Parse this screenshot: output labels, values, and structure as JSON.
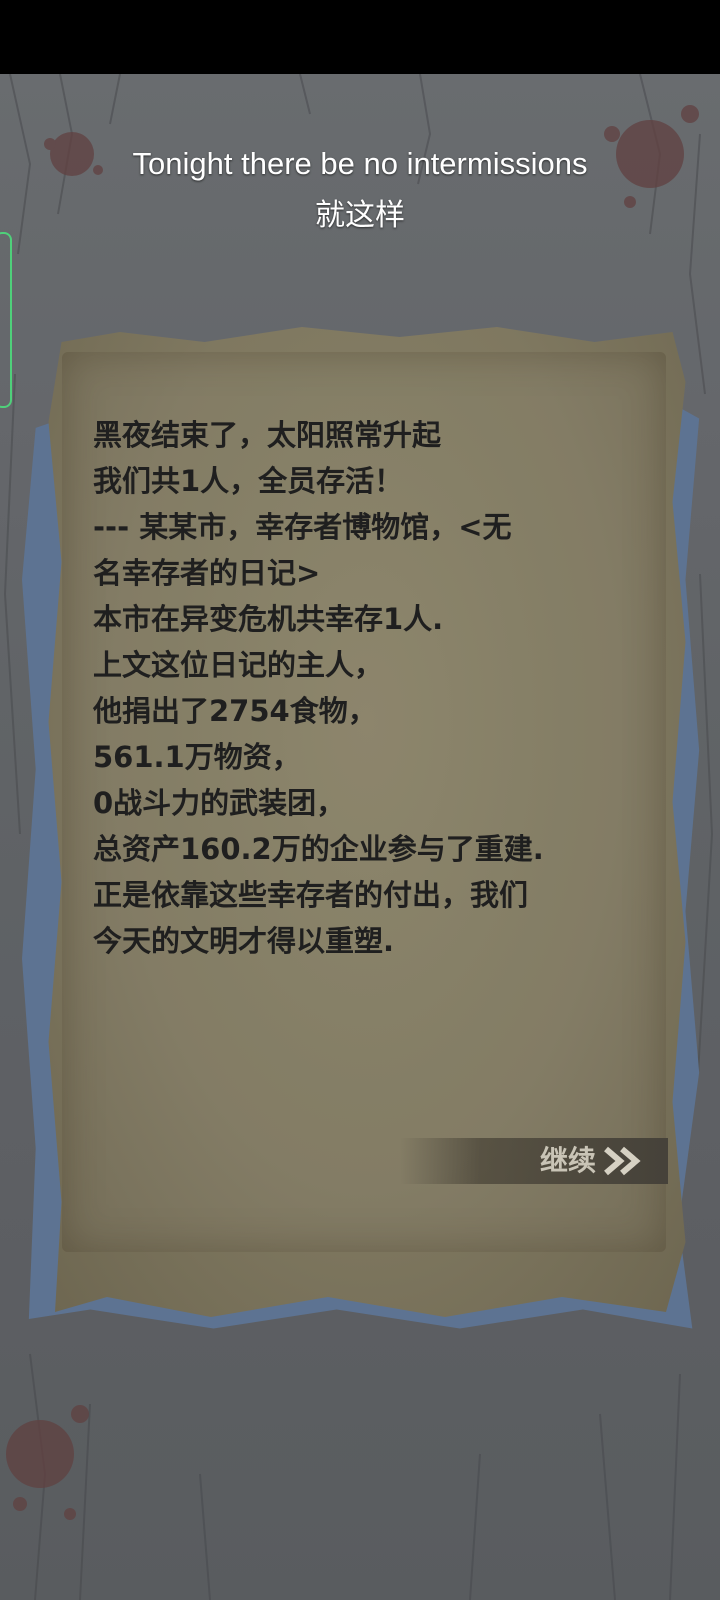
{
  "subtitle": {
    "english": "Tonight there be no intermissions",
    "chinese": "就这样"
  },
  "diary": {
    "lines": [
      "黑夜结束了，太阳照常升起",
      "我们共1人，全员存活！",
      "---  某某市，幸存者博物馆，<无",
      "名幸存者的日记>",
      "本市在异变危机共幸存1人.",
      "上文这位日记的主人，",
      "他捐出了2754食物，",
      "561.1万物资，",
      "0战斗力的武装团，",
      "总资产160.2万的企业参与了重建.",
      "正是依靠这些幸存者的付出，我们",
      "今天的文明才得以重塑."
    ]
  },
  "continue": {
    "label": "继续",
    "icon": "double-chevron-right-icon"
  },
  "colors": {
    "background": "#6f7276",
    "paper": "#7f7860",
    "paper_back": "#5d7392",
    "text": "#1f1f1f",
    "subtitle": "#ffffff",
    "side_tab_border": "#4fd07a"
  }
}
